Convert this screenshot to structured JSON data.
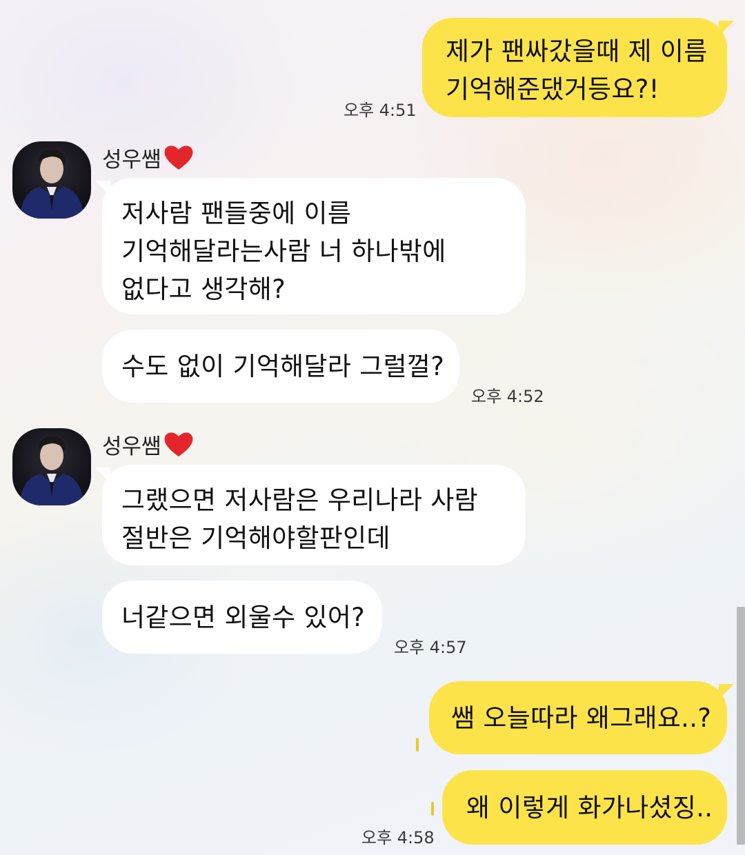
{
  "messages": [
    {
      "sender": "me",
      "lines": [
        "제가 팬싸갔을때 제 이름",
        "기억해준댔거등요?!"
      ],
      "time": "오후 4:51"
    },
    {
      "sender": "other",
      "name": "성우쌤",
      "lines": [
        "저사람 팬들중에 이름",
        "기억해달라는사람 너 하나밖에",
        "없다고 생각해?"
      ]
    },
    {
      "sender": "other",
      "lines": [
        "수도 없이 기억해달라 그럴껄?"
      ],
      "time": "오후 4:52"
    },
    {
      "sender": "other",
      "name": "성우쌤",
      "lines": [
        "그랬으면 저사람은 우리나라 사람",
        "절반은 기억해야할판인데"
      ]
    },
    {
      "sender": "other",
      "lines": [
        "너같으면 외울수 있어?"
      ],
      "time": "오후 4:57"
    },
    {
      "sender": "me",
      "lines": [
        "쌤 오늘따라 왜그래요..?"
      ]
    },
    {
      "sender": "me",
      "lines": [
        "왜 이렇게 화가나셨징.."
      ],
      "time": "오후 4:58"
    }
  ],
  "icons": {
    "name_suffix": "heart-icon",
    "avatar": "profile-photo"
  },
  "colors": {
    "my_bubble": "#fde34a",
    "other_bubble": "#ffffff",
    "heart": "#e3262b"
  }
}
